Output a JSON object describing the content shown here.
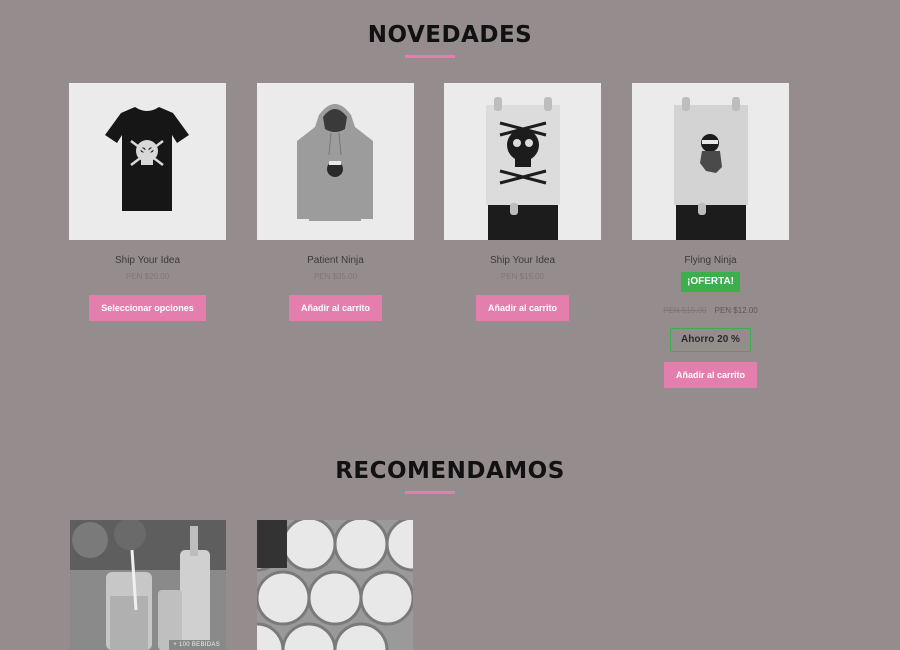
{
  "sections": {
    "novedades_title": "NOVEDADES",
    "recomendamos_title": "RECOMENDAMOS"
  },
  "products": [
    {
      "name": "Ship Your Idea",
      "price": "PEN $20.00",
      "button": "Seleccionar opciones",
      "image": "tshirt-image"
    },
    {
      "name": "Patient Ninja",
      "price": "PEN $35.00",
      "button": "Añadir al carrito",
      "image": "hoodie-image"
    },
    {
      "name": "Ship Your Idea",
      "price": "PEN $15.00",
      "button": "Añadir al carrito",
      "image": "poster-skull-image"
    },
    {
      "name": "Flying Ninja",
      "badge": "¡OFERTA!",
      "old_price": "PEN $15.00",
      "price": "PEN $12.00",
      "savings": "Ahorro 20 %",
      "button": "Añadir al carrito",
      "image": "poster-ninja-image"
    }
  ],
  "recommended": [
    {
      "image": "drinks-image",
      "tag": "+ 100 BEBIDAS"
    },
    {
      "image": "candles-image"
    }
  ],
  "colors": {
    "background": "#958d8d",
    "accent": "#e47fad",
    "sale_green": "#3cae4b"
  }
}
